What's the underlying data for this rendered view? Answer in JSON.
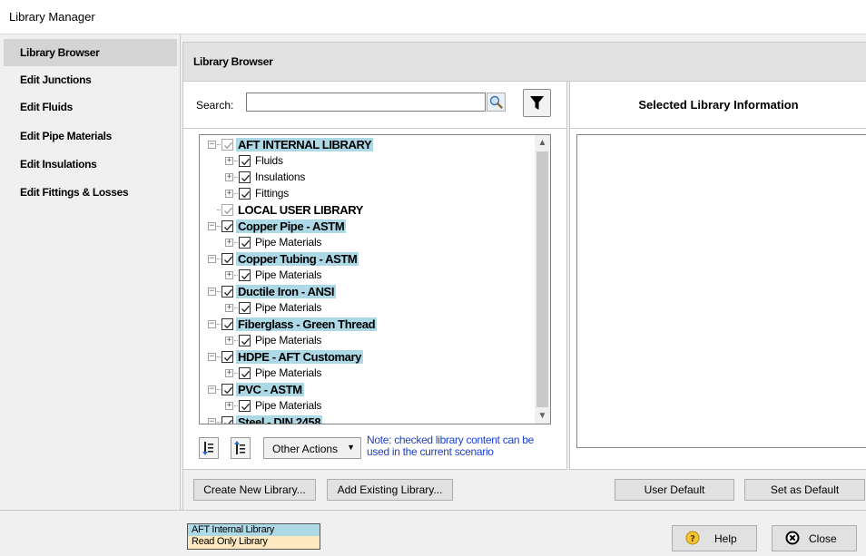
{
  "window": {
    "title": "Library Manager"
  },
  "sidebar": {
    "items": [
      {
        "label": "Library Browser",
        "active": true
      },
      {
        "label": "Edit Junctions"
      },
      {
        "label": "Edit Fluids"
      },
      {
        "label": "Edit Pipe Materials"
      },
      {
        "label": "Edit Insulations"
      },
      {
        "label": "Edit Fittings & Losses"
      }
    ]
  },
  "main": {
    "header": "Library Browser",
    "search": {
      "label": "Search:",
      "value": "",
      "search_icon": "magnifier-icon",
      "filter_icon": "funnel-icon"
    },
    "selected_info": {
      "title": "Selected Library Information"
    },
    "tree": {
      "rows": [
        {
          "label": "AFT INTERNAL LIBRARY",
          "level": 0,
          "library": true,
          "highlight": true,
          "gray_check": true
        },
        {
          "label": "Fluids",
          "level": 1
        },
        {
          "label": "Insulations",
          "level": 1
        },
        {
          "label": "Fittings",
          "level": 1
        },
        {
          "label": "LOCAL USER LIBRARY",
          "level": 0,
          "library": true,
          "highlight": false,
          "gray_check": true,
          "no_expander": true
        },
        {
          "label": "Copper Pipe - ASTM",
          "level": 0,
          "library": true,
          "highlight": true
        },
        {
          "label": "Pipe Materials",
          "level": 1
        },
        {
          "label": "Copper Tubing - ASTM",
          "level": 0,
          "library": true,
          "highlight": true
        },
        {
          "label": "Pipe Materials",
          "level": 1
        },
        {
          "label": "Ductile Iron - ANSI",
          "level": 0,
          "library": true,
          "highlight": true
        },
        {
          "label": "Pipe Materials",
          "level": 1
        },
        {
          "label": "Fiberglass - Green Thread",
          "level": 0,
          "library": true,
          "highlight": true
        },
        {
          "label": "Pipe Materials",
          "level": 1
        },
        {
          "label": "HDPE - AFT Customary",
          "level": 0,
          "library": true,
          "highlight": true
        },
        {
          "label": "Pipe Materials",
          "level": 1
        },
        {
          "label": "PVC - ASTM",
          "level": 0,
          "library": true,
          "highlight": true
        },
        {
          "label": "Pipe Materials",
          "level": 1
        },
        {
          "label": "Steel - DIN 2458",
          "level": 0,
          "library": true,
          "highlight": true
        }
      ]
    },
    "toolbar": {
      "expand_all_icon": "expand-all-icon",
      "collapse_all_icon": "collapse-all-icon",
      "other_actions": "Other Actions",
      "note": "Note: checked library content can be used in the current scenario"
    },
    "buttons": {
      "create_new": "Create New Library...",
      "add_existing": "Add Existing Library...",
      "user_default": "User Default",
      "set_default": "Set as Default"
    }
  },
  "footer": {
    "legend_internal": "AFT Internal Library",
    "legend_readonly": "Read Only Library",
    "help": "Help",
    "close": "Close"
  },
  "colors": {
    "highlight": "#add8e6",
    "readonly": "#fde8c0",
    "note_text": "#1a3fd6"
  }
}
